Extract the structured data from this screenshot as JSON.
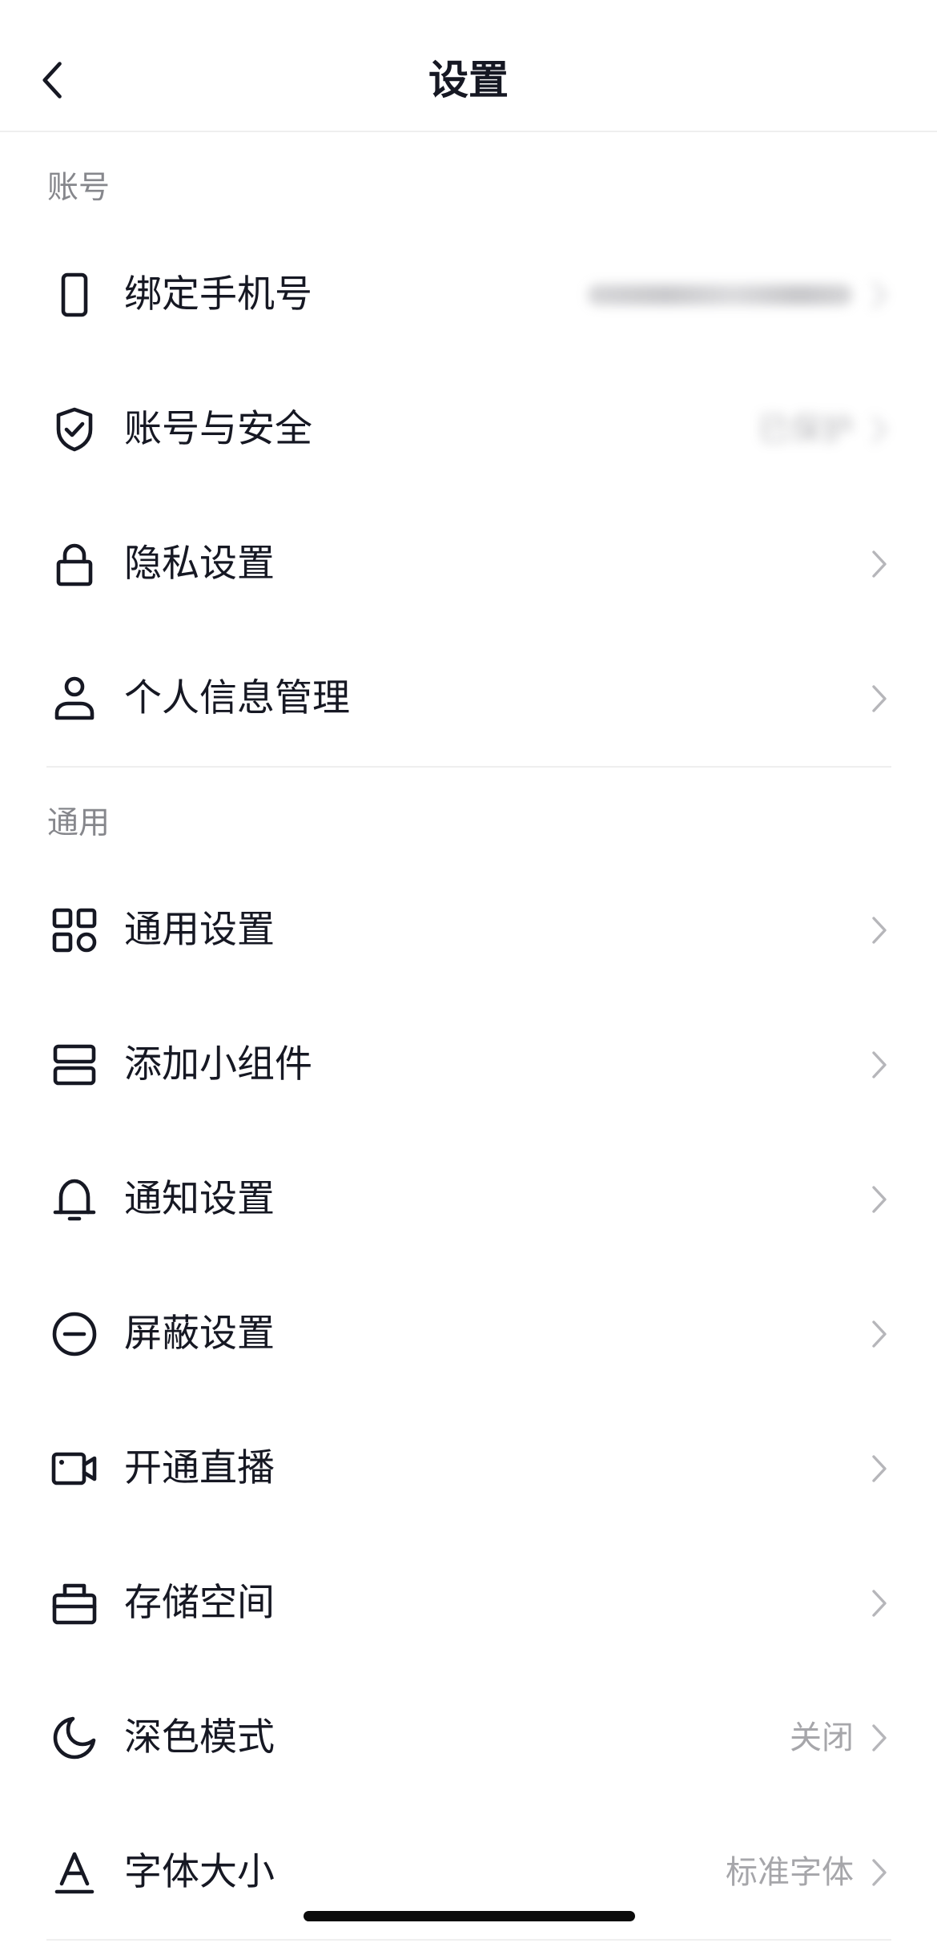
{
  "header": {
    "title": "设置",
    "back_icon": "back-arrow-icon"
  },
  "sections": [
    {
      "label": "账号",
      "items": [
        {
          "label": "绑定手机号",
          "icon": "phone-icon"
        },
        {
          "label": "账号与安全",
          "icon": "shield-check-icon",
          "value": "已保护"
        },
        {
          "label": "隐私设置",
          "icon": "lock-icon"
        },
        {
          "label": "个人信息管理",
          "icon": "person-icon"
        }
      ]
    },
    {
      "label": "通用",
      "items": [
        {
          "label": "通用设置",
          "icon": "apps-grid-icon"
        },
        {
          "label": "添加小组件",
          "icon": "widget-icon"
        },
        {
          "label": "通知设置",
          "icon": "bell-icon"
        },
        {
          "label": "屏蔽设置",
          "icon": "minus-circle-icon"
        },
        {
          "label": "开通直播",
          "icon": "video-camera-icon"
        },
        {
          "label": "存储空间",
          "icon": "storage-box-icon"
        },
        {
          "label": "深色模式",
          "icon": "moon-icon",
          "value": "关闭"
        },
        {
          "label": "字体大小",
          "icon": "font-size-icon",
          "value": "标准字体"
        }
      ]
    }
  ],
  "colors": {
    "text": "#161823",
    "section_label": "#86878c",
    "value_text": "#a6a6aa",
    "chevron": "#b6b6ba",
    "divider": "#efefef",
    "background": "#ffffff"
  }
}
